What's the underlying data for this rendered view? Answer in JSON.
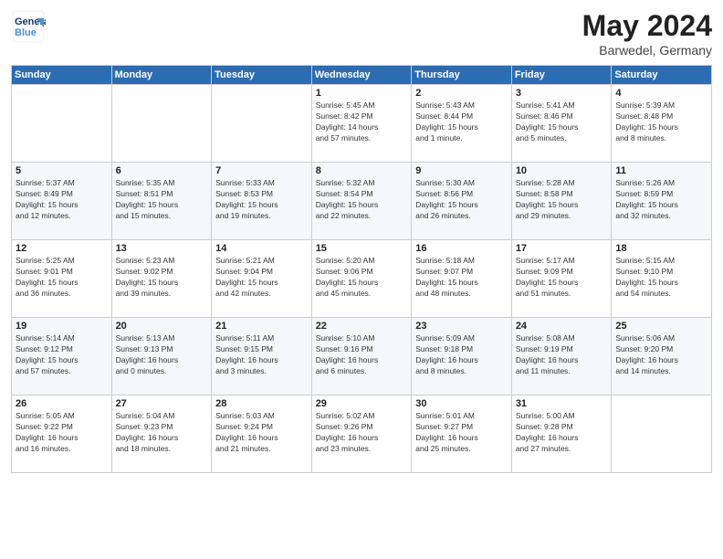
{
  "header": {
    "logo_line1": "General",
    "logo_line2": "Blue",
    "month_title": "May 2024",
    "location": "Barwedel, Germany"
  },
  "days_of_week": [
    "Sunday",
    "Monday",
    "Tuesday",
    "Wednesday",
    "Thursday",
    "Friday",
    "Saturday"
  ],
  "weeks": [
    [
      {
        "day": "",
        "info": ""
      },
      {
        "day": "",
        "info": ""
      },
      {
        "day": "",
        "info": ""
      },
      {
        "day": "1",
        "info": "Sunrise: 5:45 AM\nSunset: 8:42 PM\nDaylight: 14 hours\nand 57 minutes."
      },
      {
        "day": "2",
        "info": "Sunrise: 5:43 AM\nSunset: 8:44 PM\nDaylight: 15 hours\nand 1 minute."
      },
      {
        "day": "3",
        "info": "Sunrise: 5:41 AM\nSunset: 8:46 PM\nDaylight: 15 hours\nand 5 minutes."
      },
      {
        "day": "4",
        "info": "Sunrise: 5:39 AM\nSunset: 8:48 PM\nDaylight: 15 hours\nand 8 minutes."
      }
    ],
    [
      {
        "day": "5",
        "info": "Sunrise: 5:37 AM\nSunset: 8:49 PM\nDaylight: 15 hours\nand 12 minutes."
      },
      {
        "day": "6",
        "info": "Sunrise: 5:35 AM\nSunset: 8:51 PM\nDaylight: 15 hours\nand 15 minutes."
      },
      {
        "day": "7",
        "info": "Sunrise: 5:33 AM\nSunset: 8:53 PM\nDaylight: 15 hours\nand 19 minutes."
      },
      {
        "day": "8",
        "info": "Sunrise: 5:32 AM\nSunset: 8:54 PM\nDaylight: 15 hours\nand 22 minutes."
      },
      {
        "day": "9",
        "info": "Sunrise: 5:30 AM\nSunset: 8:56 PM\nDaylight: 15 hours\nand 26 minutes."
      },
      {
        "day": "10",
        "info": "Sunrise: 5:28 AM\nSunset: 8:58 PM\nDaylight: 15 hours\nand 29 minutes."
      },
      {
        "day": "11",
        "info": "Sunrise: 5:26 AM\nSunset: 8:59 PM\nDaylight: 15 hours\nand 32 minutes."
      }
    ],
    [
      {
        "day": "12",
        "info": "Sunrise: 5:25 AM\nSunset: 9:01 PM\nDaylight: 15 hours\nand 36 minutes."
      },
      {
        "day": "13",
        "info": "Sunrise: 5:23 AM\nSunset: 9:02 PM\nDaylight: 15 hours\nand 39 minutes."
      },
      {
        "day": "14",
        "info": "Sunrise: 5:21 AM\nSunset: 9:04 PM\nDaylight: 15 hours\nand 42 minutes."
      },
      {
        "day": "15",
        "info": "Sunrise: 5:20 AM\nSunset: 9:06 PM\nDaylight: 15 hours\nand 45 minutes."
      },
      {
        "day": "16",
        "info": "Sunrise: 5:18 AM\nSunset: 9:07 PM\nDaylight: 15 hours\nand 48 minutes."
      },
      {
        "day": "17",
        "info": "Sunrise: 5:17 AM\nSunset: 9:09 PM\nDaylight: 15 hours\nand 51 minutes."
      },
      {
        "day": "18",
        "info": "Sunrise: 5:15 AM\nSunset: 9:10 PM\nDaylight: 15 hours\nand 54 minutes."
      }
    ],
    [
      {
        "day": "19",
        "info": "Sunrise: 5:14 AM\nSunset: 9:12 PM\nDaylight: 15 hours\nand 57 minutes."
      },
      {
        "day": "20",
        "info": "Sunrise: 5:13 AM\nSunset: 9:13 PM\nDaylight: 16 hours\nand 0 minutes."
      },
      {
        "day": "21",
        "info": "Sunrise: 5:11 AM\nSunset: 9:15 PM\nDaylight: 16 hours\nand 3 minutes."
      },
      {
        "day": "22",
        "info": "Sunrise: 5:10 AM\nSunset: 9:16 PM\nDaylight: 16 hours\nand 6 minutes."
      },
      {
        "day": "23",
        "info": "Sunrise: 5:09 AM\nSunset: 9:18 PM\nDaylight: 16 hours\nand 8 minutes."
      },
      {
        "day": "24",
        "info": "Sunrise: 5:08 AM\nSunset: 9:19 PM\nDaylight: 16 hours\nand 11 minutes."
      },
      {
        "day": "25",
        "info": "Sunrise: 5:06 AM\nSunset: 9:20 PM\nDaylight: 16 hours\nand 14 minutes."
      }
    ],
    [
      {
        "day": "26",
        "info": "Sunrise: 5:05 AM\nSunset: 9:22 PM\nDaylight: 16 hours\nand 16 minutes."
      },
      {
        "day": "27",
        "info": "Sunrise: 5:04 AM\nSunset: 9:23 PM\nDaylight: 16 hours\nand 18 minutes."
      },
      {
        "day": "28",
        "info": "Sunrise: 5:03 AM\nSunset: 9:24 PM\nDaylight: 16 hours\nand 21 minutes."
      },
      {
        "day": "29",
        "info": "Sunrise: 5:02 AM\nSunset: 9:26 PM\nDaylight: 16 hours\nand 23 minutes."
      },
      {
        "day": "30",
        "info": "Sunrise: 5:01 AM\nSunset: 9:27 PM\nDaylight: 16 hours\nand 25 minutes."
      },
      {
        "day": "31",
        "info": "Sunrise: 5:00 AM\nSunset: 9:28 PM\nDaylight: 16 hours\nand 27 minutes."
      },
      {
        "day": "",
        "info": ""
      }
    ]
  ]
}
